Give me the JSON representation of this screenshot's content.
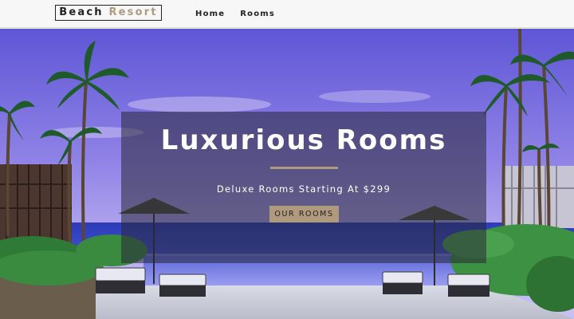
{
  "navbar": {
    "logo": {
      "part1": "Beach",
      "part2": "Resort"
    },
    "links": [
      {
        "label": "Home"
      },
      {
        "label": "Rooms"
      }
    ]
  },
  "hero": {
    "title": "Luxurious Rooms",
    "subtitle": "Deluxe Rooms Starting At $299",
    "button_label": "OUR ROOMS",
    "scene": "tropical-infinity-pool-photo"
  },
  "colors": {
    "accent": "#af9a7d",
    "nav_background": "#f7f7f7",
    "text_dark": "#222222",
    "banner_overlay": "rgba(40,40,55,0.55)"
  }
}
